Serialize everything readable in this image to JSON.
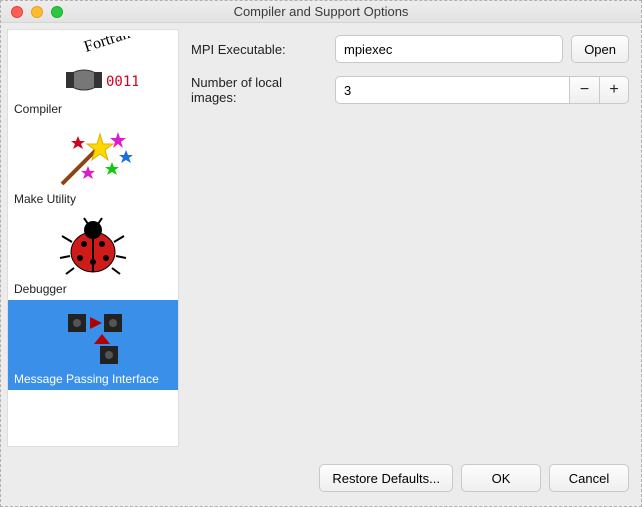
{
  "window": {
    "title": "Compiler and Support Options"
  },
  "sidebar": {
    "items": [
      {
        "label": "Compiler"
      },
      {
        "label": "Make Utility"
      },
      {
        "label": "Debugger"
      },
      {
        "label": "Message Passing Interface"
      }
    ],
    "selected_index": 3
  },
  "main": {
    "mpi_label": "MPI Executable:",
    "mpi_value": "mpiexec",
    "open_label": "Open",
    "images_label": "Number of local images:",
    "images_value": "3",
    "minus": "−",
    "plus": "+"
  },
  "footer": {
    "restore": "Restore Defaults...",
    "ok": "OK",
    "cancel": "Cancel"
  }
}
